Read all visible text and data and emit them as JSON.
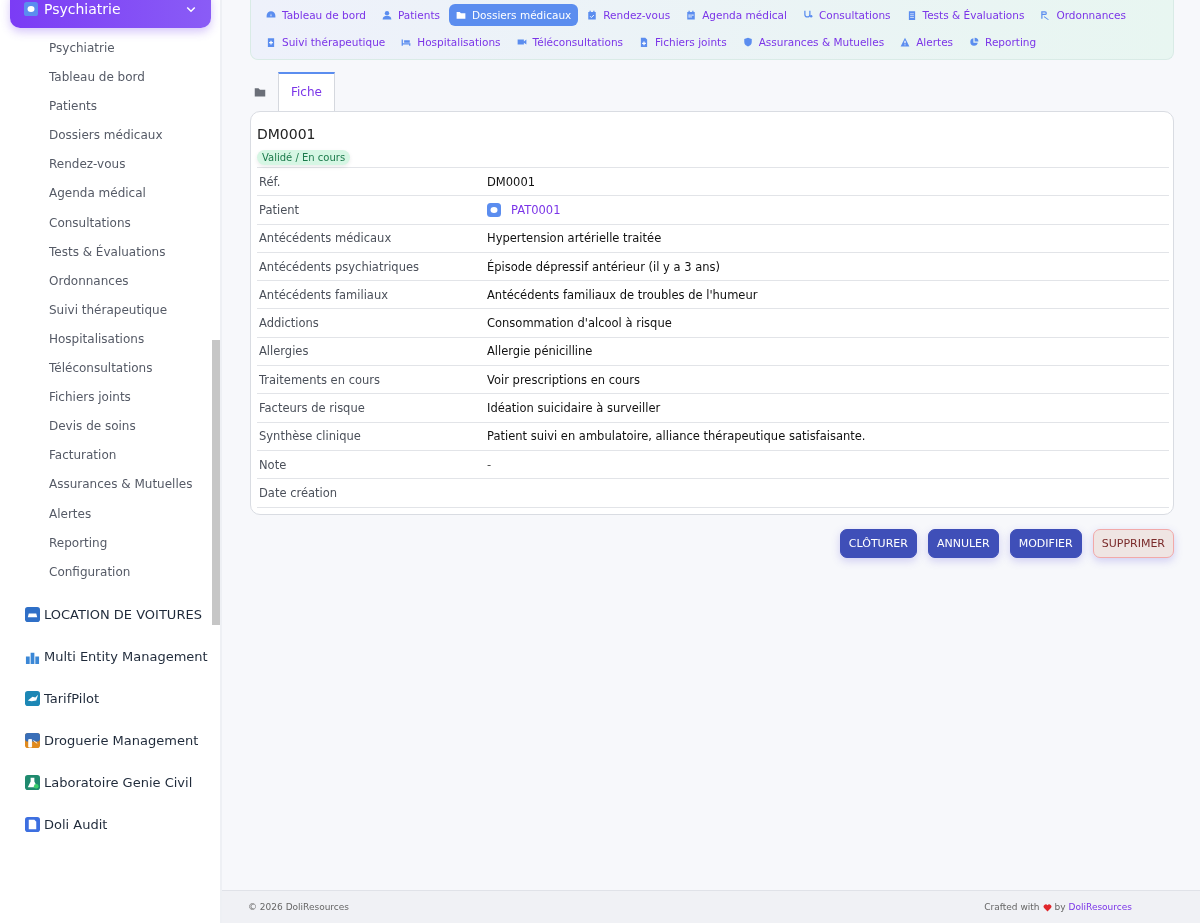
{
  "sidebar": {
    "menu": {
      "label": "Psychiatrie",
      "expanded": true
    },
    "items": [
      "Psychiatrie",
      "Tableau de bord",
      "Patients",
      "Dossiers médicaux",
      "Rendez-vous",
      "Agenda médical",
      "Consultations",
      "Tests & Évaluations",
      "Ordonnances",
      "Suivi thérapeutique",
      "Hospitalisations",
      "Téléconsultations",
      "Fichiers joints",
      "Devis de soins",
      "Facturation",
      "Assurances & Mutuelles",
      "Alertes",
      "Reporting",
      "Configuration"
    ],
    "modules": [
      "LOCATION DE VOITURES",
      "Multi Entity Management",
      "TarifPilot",
      "Droguerie Management",
      "Laboratoire Genie Civil",
      "Doli Audit"
    ]
  },
  "nav": [
    {
      "label": "Tableau de bord",
      "selected": false
    },
    {
      "label": "Patients",
      "selected": false
    },
    {
      "label": "Dossiers médicaux",
      "selected": true
    },
    {
      "label": "Rendez-vous",
      "selected": false
    },
    {
      "label": "Agenda médical",
      "selected": false
    },
    {
      "label": "Consultations",
      "selected": false
    },
    {
      "label": "Tests & Évaluations",
      "selected": false
    },
    {
      "label": "Ordonnances",
      "selected": false
    },
    {
      "label": "Suivi thérapeutique",
      "selected": false
    },
    {
      "label": "Hospitalisations",
      "selected": false
    },
    {
      "label": "Téléconsultations",
      "selected": false
    },
    {
      "label": "Fichiers joints",
      "selected": false
    },
    {
      "label": "Assurances & Mutuelles",
      "selected": false
    },
    {
      "label": "Alertes",
      "selected": false
    },
    {
      "label": "Reporting",
      "selected": false
    }
  ],
  "tabs": [
    {
      "label": "Fiche",
      "selected": true
    }
  ],
  "record": {
    "title": "DM0001",
    "status": "Validé / En cours",
    "fields": [
      {
        "label": "Réf.",
        "value": "DM0001",
        "kind": "text"
      },
      {
        "label": "Patient",
        "value": "PAT0001",
        "kind": "link"
      },
      {
        "label": "Antécédents médicaux",
        "value": "Hypertension artérielle traitée",
        "kind": "text"
      },
      {
        "label": "Antécédents psychiatriques",
        "value": "Épisode dépressif antérieur (il y a 3 ans)",
        "kind": "text"
      },
      {
        "label": "Antécédents familiaux",
        "value": "Antécédents familiaux de troubles de l'humeur",
        "kind": "text"
      },
      {
        "label": "Addictions",
        "value": "Consommation d'alcool à risque",
        "kind": "text"
      },
      {
        "label": "Allergies",
        "value": "Allergie pénicilline",
        "kind": "text"
      },
      {
        "label": "Traitements en cours",
        "value": "Voir prescriptions en cours",
        "kind": "text"
      },
      {
        "label": "Facteurs de risque",
        "value": "Idéation suicidaire à surveiller",
        "kind": "text"
      },
      {
        "label": "Synthèse clinique",
        "value": "Patient suivi en ambulatoire, alliance thérapeutique satisfaisante.",
        "kind": "text"
      },
      {
        "label": "Note",
        "value": "-",
        "kind": "muted"
      },
      {
        "label": "Date création"
      }
    ]
  },
  "buttons": [
    {
      "label": "CLÔTURER",
      "kind": "primary"
    },
    {
      "label": "ANNULER",
      "kind": "primary"
    },
    {
      "label": "MODIFIER",
      "kind": "primary"
    },
    {
      "label": "SUPPRIMER",
      "kind": "danger"
    }
  ],
  "footer": {
    "copyright": "© 2026 DoliResources",
    "credit": "Crafted with",
    "by": "by",
    "link": "DoliResources"
  }
}
